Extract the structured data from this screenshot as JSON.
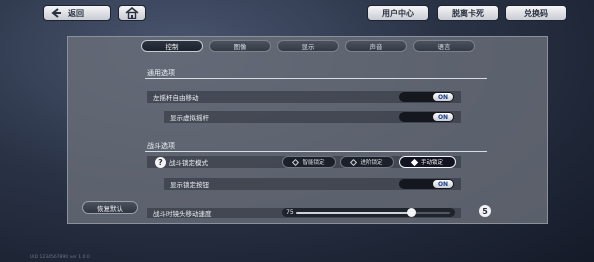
{
  "topbar": {
    "back_label": "返回",
    "user_center": "用户中心",
    "leave_card": "脱离卡死",
    "redeem_code": "兑换码"
  },
  "tabs": [
    {
      "label": "控制",
      "active": true
    },
    {
      "label": "图像",
      "active": false
    },
    {
      "label": "显示",
      "active": false
    },
    {
      "label": "声音",
      "active": false
    },
    {
      "label": "语言",
      "active": false
    }
  ],
  "general": {
    "title": "通用选项",
    "rows": [
      {
        "label": "左摇杆自由移动",
        "toggle": "ON"
      },
      {
        "label": "显示虚拟摇杆",
        "toggle": "ON"
      }
    ]
  },
  "combat": {
    "title": "战斗选项",
    "lock_mode": {
      "label": "战斗锁定模式",
      "help_icon_text": "?",
      "options": [
        "智能锁定",
        "进阶锁定",
        "手动锁定"
      ],
      "selected": "手动锁定"
    },
    "show_lock_button": {
      "label": "显示锁定按钮",
      "toggle": "ON"
    },
    "camera_speed": {
      "label": "战斗时镜头移动速度",
      "value": "75",
      "percent": 75
    },
    "info_badge": "5"
  },
  "reset_button": "恢复默认",
  "footer": "UID 1234567890 ver 1.0.0",
  "colors": {
    "toggle_on_text": "#1a3e86",
    "panel_bg": "#6e737d"
  }
}
